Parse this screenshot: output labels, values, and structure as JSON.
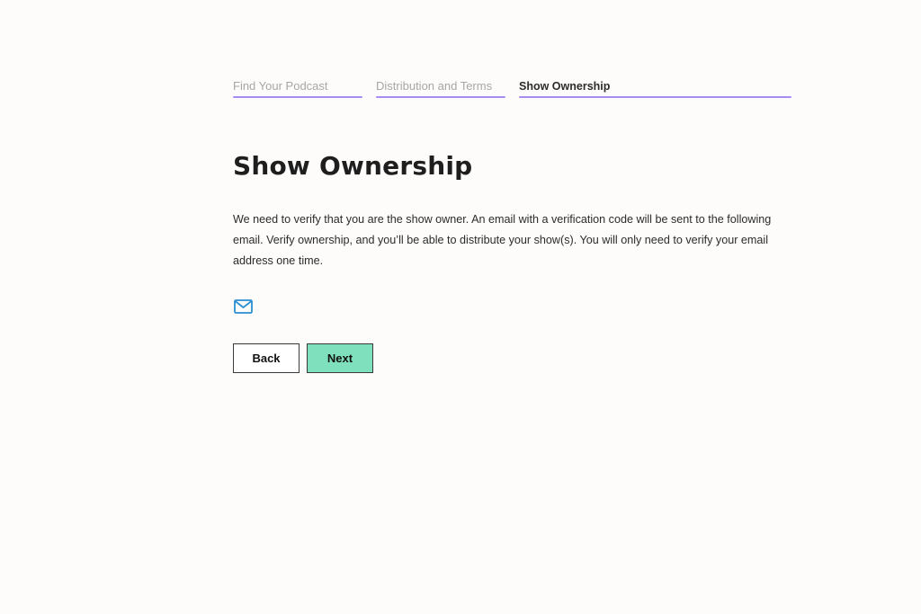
{
  "steps": [
    {
      "label": "Find Your Podcast",
      "state": "complete"
    },
    {
      "label": "Distribution and Terms",
      "state": "complete"
    },
    {
      "label": "Show Ownership",
      "state": "active"
    }
  ],
  "page": {
    "title": "Show Ownership",
    "description": "We need to verify that you are the show owner. An email with a verification code will be sent to the following email. Verify ownership, and you’ll be able to distribute your show(s). You will only need to verify your email address one time."
  },
  "email": {
    "icon": "mail-icon",
    "address": ""
  },
  "buttons": {
    "back_label": "Back",
    "next_label": "Next"
  },
  "colors": {
    "step_bar": "#a58df2",
    "next_button": "#7ee0bd",
    "mail_icon": "#2a8fd1",
    "title": "#1e1e1e"
  }
}
